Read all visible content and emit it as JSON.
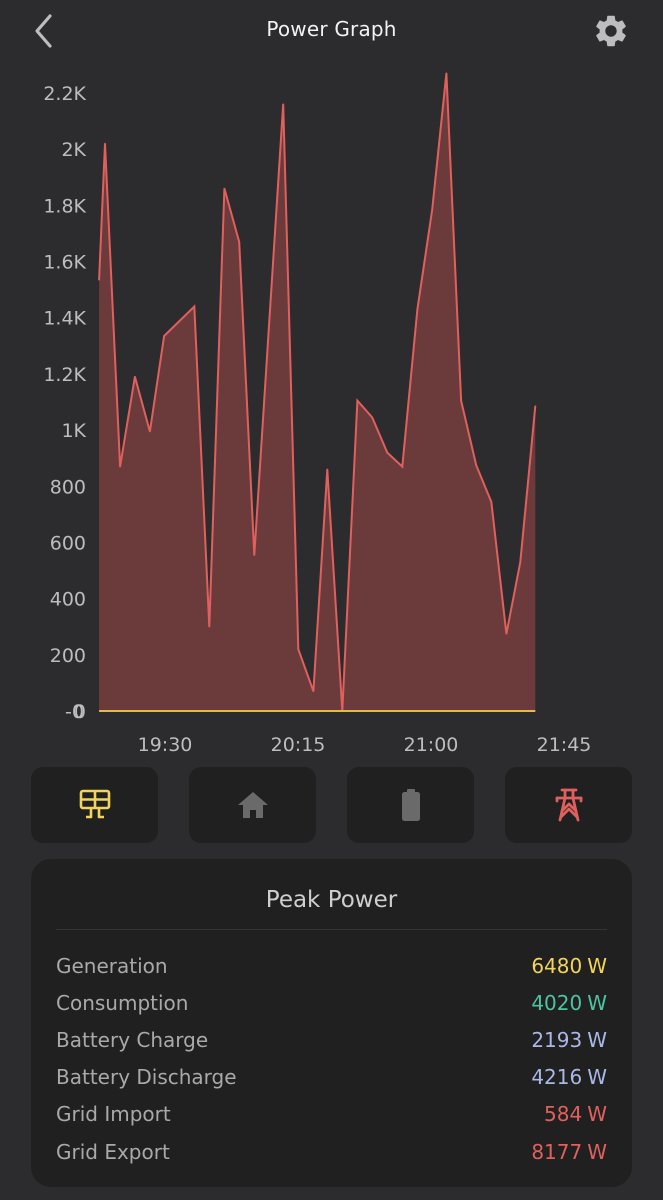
{
  "header": {
    "title": "Power Graph",
    "back_icon": "chevron-left-icon",
    "settings_icon": "gear-icon"
  },
  "chart_data": {
    "type": "area",
    "title": "",
    "xlabel": "",
    "ylabel": "",
    "series": [
      {
        "name": "Grid",
        "color": "#e0605e",
        "fill": "#6b3b3c",
        "x_minutes_after_19_00": [
          7.7,
          9.7,
          14.8,
          19.8,
          24.9,
          29.7,
          39.9,
          45.0,
          50.1,
          55.1,
          60.2,
          70.0,
          75.1,
          80.2,
          84.9,
          90.0,
          95.1,
          100.1,
          105.2,
          110.3,
          115.4,
          120.4,
          125.2,
          130.2,
          135.3,
          140.4,
          145.5,
          150.2,
          155.3
        ],
        "values": [
          1535,
          2020,
          870,
          1190,
          995,
          1335,
          1440,
          300,
          1860,
          1670,
          555,
          2160,
          220,
          70,
          860,
          0,
          1105,
          1045,
          920,
          870,
          1430,
          1785,
          2270,
          1105,
          875,
          745,
          275,
          530,
          1085
        ]
      },
      {
        "name": "Baseline",
        "color": "#e8b84a",
        "x_minutes_after_19_00": [
          7.7,
          155.3
        ],
        "values": [
          0,
          0
        ]
      }
    ],
    "y_ticks": [
      {
        "value": 0,
        "label": "0"
      },
      {
        "value": 0,
        "label": "-0"
      },
      {
        "value": 200,
        "label": "200"
      },
      {
        "value": 400,
        "label": "400"
      },
      {
        "value": 600,
        "label": "600"
      },
      {
        "value": 800,
        "label": "800"
      },
      {
        "value": 1000,
        "label": "1K"
      },
      {
        "value": 1200,
        "label": "1.2K"
      },
      {
        "value": 1400,
        "label": "1.4K"
      },
      {
        "value": 1600,
        "label": "1.6K"
      },
      {
        "value": 1800,
        "label": "1.8K"
      },
      {
        "value": 2000,
        "label": "2K"
      },
      {
        "value": 2200,
        "label": "2.2K"
      }
    ],
    "x_ticks": [
      {
        "minutes_after_19_00": 30,
        "label": "19:30"
      },
      {
        "minutes_after_19_00": 75,
        "label": "20:15"
      },
      {
        "minutes_after_19_00": 120,
        "label": "21:00"
      },
      {
        "minutes_after_19_00": 165,
        "label": "21:45"
      }
    ],
    "ylim": [
      0,
      2200
    ],
    "xlim_minutes_after_19_00": [
      7.7,
      155.3
    ],
    "grid": false,
    "legend": "none"
  },
  "tabs": [
    {
      "name": "solar",
      "icon": "solar-panel-icon",
      "color": "#f2d45c",
      "active": true
    },
    {
      "name": "home",
      "icon": "home-icon",
      "color": "#6a6a6a",
      "active": false
    },
    {
      "name": "battery",
      "icon": "battery-icon",
      "color": "#6a6a6a",
      "active": false
    },
    {
      "name": "grid",
      "icon": "power-pylon-icon",
      "color": "#e0605e",
      "active": false
    }
  ],
  "peak_power": {
    "title": "Peak Power",
    "rows": [
      {
        "label": "Generation",
        "value": "6480",
        "unit": "W",
        "color": "#f2d45c"
      },
      {
        "label": "Consumption",
        "value": "4020",
        "unit": "W",
        "color": "#4fc3a1"
      },
      {
        "label": "Battery Charge",
        "value": "2193",
        "unit": "W",
        "color": "#a9b8e6"
      },
      {
        "label": "Battery Discharge",
        "value": "4216",
        "unit": "W",
        "color": "#a9b8e6"
      },
      {
        "label": "Grid Import",
        "value": "584",
        "unit": "W",
        "color": "#e0605e"
      },
      {
        "label": "Grid Export",
        "value": "8177",
        "unit": "W",
        "color": "#e0605e"
      }
    ]
  }
}
